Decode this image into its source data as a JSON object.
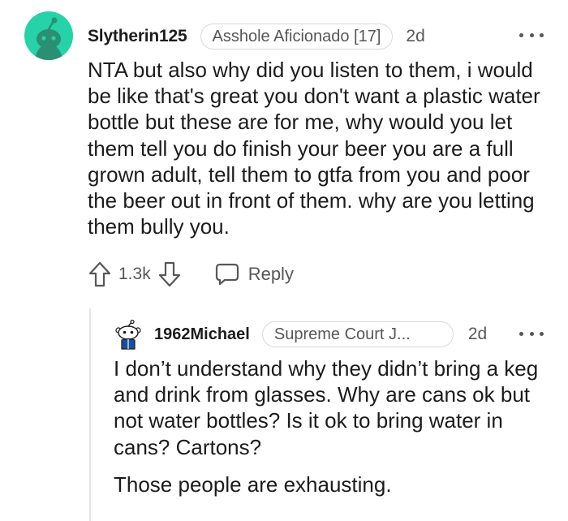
{
  "comment": {
    "username": "Slytherin125",
    "flair": "Asshole Aficionado [17]",
    "age": "2d",
    "avatar_icon": "snoo-avatar-icon",
    "avatar_color": "#26d2a8",
    "body": "NTA but also why did you listen to them, i would be like that's great you don't want a plastic water bottle but these are for me, why would you let them tell you do finish your beer you are a full grown adult, tell them to gtfa from you and poor the beer out in front of them. why are you letting them bully you.",
    "score": "1.3k",
    "reply_label": "Reply",
    "icons": {
      "upvote": "upvote-arrow-icon",
      "downvote": "downvote-arrow-icon",
      "reply": "speech-bubble-icon",
      "more": "more-options-icon"
    }
  },
  "reply": {
    "username": "1962Michael",
    "flair": "Supreme Court J...",
    "age": "2d",
    "avatar_icon": "snoo-avatar-icon",
    "paragraphs": [
      "I don’t understand why they didn’t bring a keg and drink from glasses. Why are cans ok but not water bottles? Is it ok to bring water in cans? Cartons?",
      "Those people are exhausting."
    ]
  }
}
